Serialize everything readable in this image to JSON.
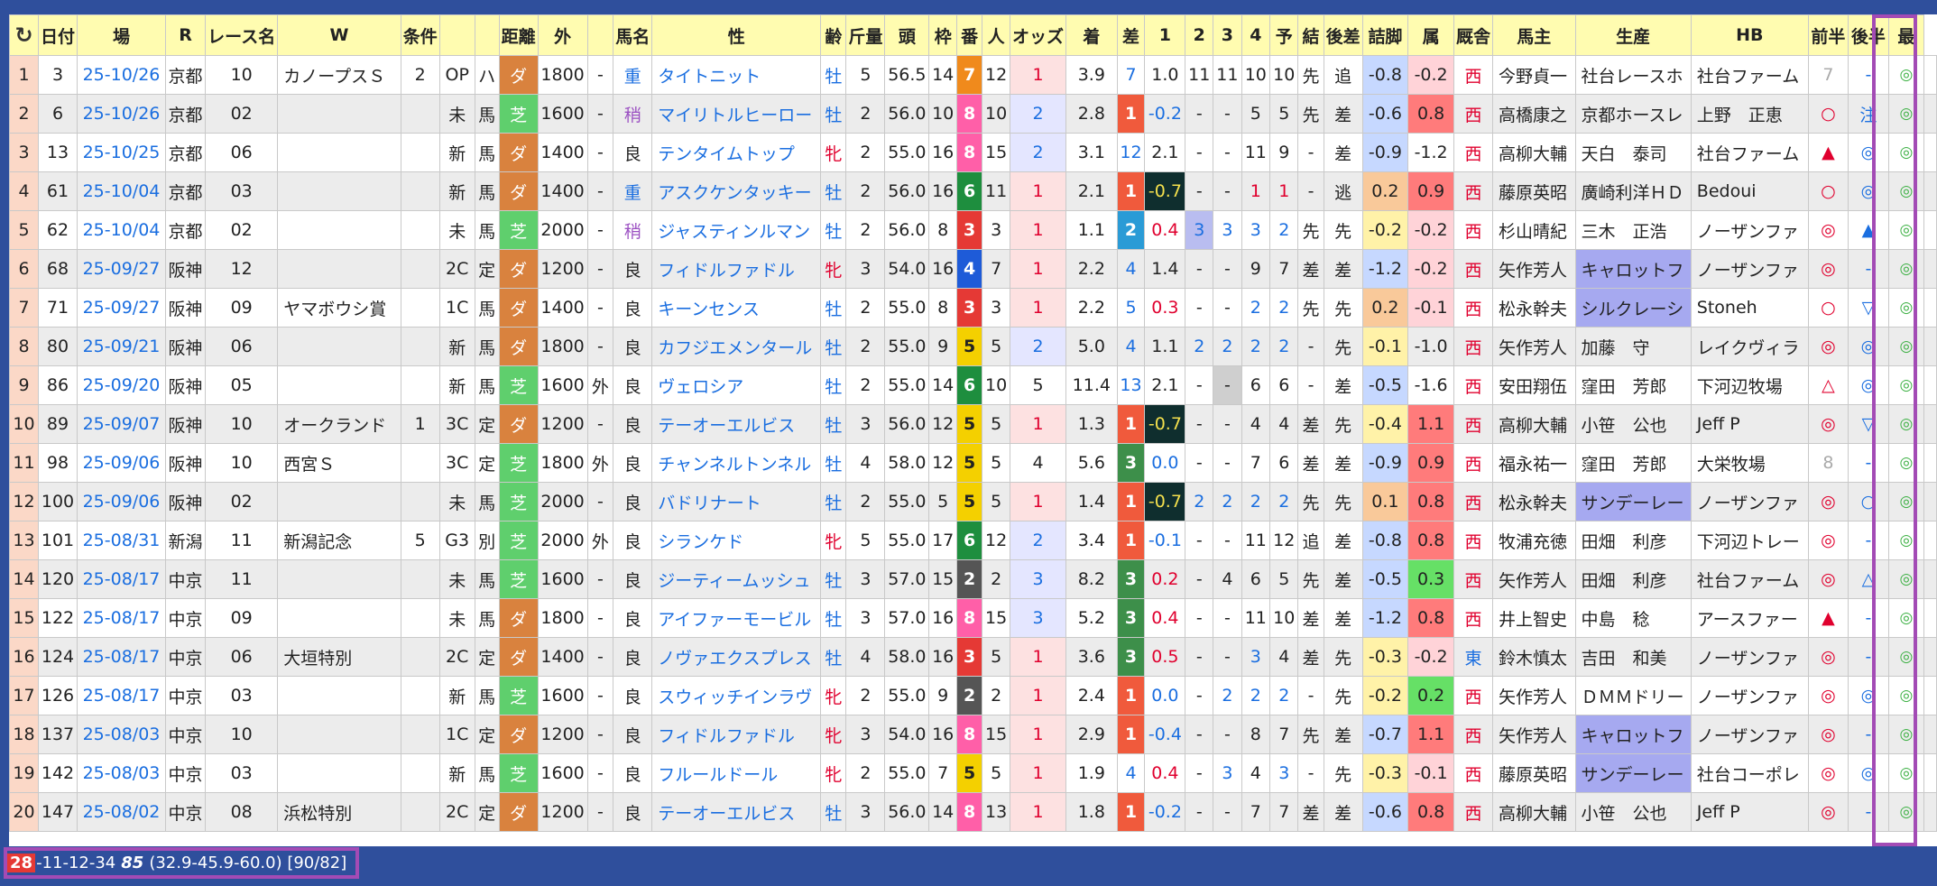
{
  "headers": [
    "↻",
    "日付",
    "場",
    "R",
    "レース名",
    "W",
    "条件",
    "",
    "",
    "距離",
    "外",
    "",
    "馬名",
    "性",
    "齢",
    "斤量",
    "頭",
    "枠",
    "番",
    "人",
    "オッズ",
    "着",
    "差",
    "1",
    "2",
    "3",
    "4",
    "予",
    "結",
    "後差",
    "詰脚",
    "属",
    "厩舎",
    "馬主",
    "生産",
    "HB",
    "前半",
    "後半",
    "最"
  ],
  "rows": [
    {
      "idx": "1",
      "no": "3",
      "date": "25-10/26",
      "place": "京都",
      "r": "10",
      "race": "カノープスＳ",
      "w": "2",
      "cond": "OP",
      "cond2": "ハ",
      "track": "ダ",
      "dist": "1800",
      "soto": "-",
      "baba": "重",
      "horse": "タイトニット",
      "sex": "牡",
      "age": "5",
      "kin": "56.5",
      "tou": "14",
      "waku": "7",
      "ban": "12",
      "nin": "1",
      "odds": "3.9",
      "chaku": "7",
      "sa": "1.0",
      "c1": "11",
      "c2": "11",
      "c3": "10",
      "c4": "10",
      "yo": "先",
      "ke": "追",
      "ato": "-0.8",
      "tsu": "-0.2",
      "zoku": "西",
      "kyu": "今野貞一",
      "owner": "社台レースホ",
      "prod": "社台ファーム",
      "hb": "7",
      "zen": "-",
      "kohan": "◎"
    },
    {
      "idx": "2",
      "no": "6",
      "date": "25-10/26",
      "place": "京都",
      "r": "02",
      "race": "",
      "w": "",
      "cond": "未",
      "cond2": "馬",
      "track": "芝",
      "dist": "1600",
      "soto": "-",
      "baba": "稍",
      "horse": "マイリトルヒーロー",
      "sex": "牡",
      "age": "2",
      "kin": "56.0",
      "tou": "10",
      "waku": "8",
      "ban": "10",
      "nin": "2",
      "odds": "2.8",
      "chaku": "1",
      "sa": "-0.2",
      "c1": "-",
      "c2": "-",
      "c3": "5",
      "c4": "5",
      "yo": "先",
      "ke": "差",
      "ato": "-0.6",
      "tsu": "0.8",
      "zoku": "西",
      "kyu": "高橋康之",
      "owner": "京都ホースレ",
      "prod": "上野　正恵",
      "hb": "○",
      "zen": "注",
      "kohan": "◎"
    },
    {
      "idx": "3",
      "no": "13",
      "date": "25-10/25",
      "place": "京都",
      "r": "06",
      "race": "",
      "w": "",
      "cond": "新",
      "cond2": "馬",
      "track": "ダ",
      "dist": "1400",
      "soto": "-",
      "baba": "良",
      "horse": "テンタイムトップ",
      "sex": "牝",
      "age": "2",
      "kin": "55.0",
      "tou": "16",
      "waku": "8",
      "ban": "15",
      "nin": "2",
      "odds": "3.1",
      "chaku": "12",
      "sa": "2.1",
      "c1": "-",
      "c2": "-",
      "c3": "11",
      "c4": "9",
      "yo": "-",
      "ke": "差",
      "ato": "-0.9",
      "tsu": "-1.2",
      "zoku": "西",
      "kyu": "高柳大輔",
      "owner": "天白　泰司",
      "prod": "社台ファーム",
      "hb": "▲",
      "zen": "◎",
      "kohan": "◎"
    },
    {
      "idx": "4",
      "no": "61",
      "date": "25-10/04",
      "place": "京都",
      "r": "03",
      "race": "",
      "w": "",
      "cond": "新",
      "cond2": "馬",
      "track": "ダ",
      "dist": "1400",
      "soto": "-",
      "baba": "重",
      "horse": "アスクケンタッキー",
      "sex": "牡",
      "age": "2",
      "kin": "56.0",
      "tou": "16",
      "waku": "6",
      "ban": "11",
      "nin": "1",
      "odds": "2.1",
      "chaku": "1",
      "sa": "-0.7",
      "c1": "-",
      "c2": "-",
      "c3": "1",
      "c4": "1",
      "yo": "-",
      "ke": "逃",
      "ato": "0.2",
      "tsu": "0.9",
      "zoku": "西",
      "kyu": "藤原英昭",
      "owner": "廣崎利洋ＨＤ",
      "prod": "Bedoui",
      "hb": "○",
      "zen": "◎",
      "kohan": "◎"
    },
    {
      "idx": "5",
      "no": "62",
      "date": "25-10/04",
      "place": "京都",
      "r": "02",
      "race": "",
      "w": "",
      "cond": "未",
      "cond2": "馬",
      "track": "芝",
      "dist": "2000",
      "soto": "-",
      "baba": "稍",
      "horse": "ジャスティンルマン",
      "sex": "牡",
      "age": "2",
      "kin": "56.0",
      "tou": "8",
      "waku": "3",
      "ban": "3",
      "nin": "1",
      "odds": "1.1",
      "chaku": "2",
      "sa": "0.4",
      "c1": "3",
      "c2": "3",
      "c3": "3",
      "c4": "2",
      "yo": "先",
      "ke": "先",
      "ato": "-0.2",
      "tsu": "-0.2",
      "zoku": "西",
      "kyu": "杉山晴紀",
      "owner": "三木　正浩",
      "prod": "ノーザンファ",
      "hb": "◎",
      "zen": "▲",
      "kohan": "◎"
    },
    {
      "idx": "6",
      "no": "68",
      "date": "25-09/27",
      "place": "阪神",
      "r": "12",
      "race": "",
      "w": "",
      "cond": "2C",
      "cond2": "定",
      "track": "ダ",
      "dist": "1200",
      "soto": "-",
      "baba": "良",
      "horse": "フィドルファドル",
      "sex": "牝",
      "age": "3",
      "kin": "54.0",
      "tou": "16",
      "waku": "4",
      "ban": "7",
      "nin": "1",
      "odds": "2.2",
      "chaku": "4",
      "sa": "1.4",
      "c1": "-",
      "c2": "-",
      "c3": "9",
      "c4": "7",
      "yo": "差",
      "ke": "差",
      "ato": "-1.2",
      "tsu": "-0.2",
      "zoku": "西",
      "kyu": "矢作芳人",
      "owner": "キャロットフ",
      "prod": "ノーザンファ",
      "hb": "◎",
      "zen": "-",
      "kohan": "◎"
    },
    {
      "idx": "7",
      "no": "71",
      "date": "25-09/27",
      "place": "阪神",
      "r": "09",
      "race": "ヤマボウシ賞",
      "w": "",
      "cond": "1C",
      "cond2": "馬",
      "track": "ダ",
      "dist": "1400",
      "soto": "-",
      "baba": "良",
      "horse": "キーンセンス",
      "sex": "牡",
      "age": "2",
      "kin": "55.0",
      "tou": "8",
      "waku": "3",
      "ban": "3",
      "nin": "1",
      "odds": "2.2",
      "chaku": "5",
      "sa": "0.3",
      "c1": "-",
      "c2": "-",
      "c3": "2",
      "c4": "2",
      "yo": "先",
      "ke": "先",
      "ato": "0.2",
      "tsu": "-0.1",
      "zoku": "西",
      "kyu": "松永幹夫",
      "owner": "シルクレーシ",
      "prod": "Stoneh",
      "hb": "○",
      "zen": "▽",
      "kohan": "◎"
    },
    {
      "idx": "8",
      "no": "80",
      "date": "25-09/21",
      "place": "阪神",
      "r": "06",
      "race": "",
      "w": "",
      "cond": "新",
      "cond2": "馬",
      "track": "ダ",
      "dist": "1800",
      "soto": "-",
      "baba": "良",
      "horse": "カフジエメンタール",
      "sex": "牡",
      "age": "2",
      "kin": "55.0",
      "tou": "9",
      "waku": "5",
      "ban": "5",
      "nin": "2",
      "odds": "5.0",
      "chaku": "4",
      "sa": "1.1",
      "c1": "2",
      "c2": "2",
      "c3": "2",
      "c4": "2",
      "yo": "-",
      "ke": "先",
      "ato": "-0.1",
      "tsu": "-1.0",
      "zoku": "西",
      "kyu": "矢作芳人",
      "owner": "加藤　守",
      "prod": "レイクヴィラ",
      "hb": "◎",
      "zen": "◎",
      "kohan": "◎"
    },
    {
      "idx": "9",
      "no": "86",
      "date": "25-09/20",
      "place": "阪神",
      "r": "05",
      "race": "",
      "w": "",
      "cond": "新",
      "cond2": "馬",
      "track": "芝",
      "dist": "1600",
      "soto": "外",
      "baba": "良",
      "horse": "ヴェロシア",
      "sex": "牡",
      "age": "2",
      "kin": "55.0",
      "tou": "14",
      "waku": "6",
      "ban": "10",
      "nin": "5",
      "odds": "11.4",
      "chaku": "13",
      "sa": "2.1",
      "c1": "-",
      "c2": "-",
      "c3": "6",
      "c4": "6",
      "yo": "-",
      "ke": "差",
      "ato": "-0.5",
      "tsu": "-1.6",
      "zoku": "西",
      "kyu": "安田翔伍",
      "owner": "窪田　芳郎",
      "prod": "下河辺牧場",
      "hb": "△",
      "zen": "◎",
      "kohan": "◎"
    },
    {
      "idx": "10",
      "no": "89",
      "date": "25-09/07",
      "place": "阪神",
      "r": "10",
      "race": "オークランド",
      "w": "1",
      "cond": "3C",
      "cond2": "定",
      "track": "ダ",
      "dist": "1200",
      "soto": "-",
      "baba": "良",
      "horse": "テーオーエルビス",
      "sex": "牡",
      "age": "3",
      "kin": "56.0",
      "tou": "12",
      "waku": "5",
      "ban": "5",
      "nin": "1",
      "odds": "1.3",
      "chaku": "1",
      "sa": "-0.7",
      "c1": "-",
      "c2": "-",
      "c3": "4",
      "c4": "4",
      "yo": "差",
      "ke": "先",
      "ato": "-0.4",
      "tsu": "1.1",
      "zoku": "西",
      "kyu": "高柳大輔",
      "owner": "小笹　公也",
      "prod": "Jeff P",
      "hb": "◎",
      "zen": "▽",
      "kohan": "◎"
    },
    {
      "idx": "11",
      "no": "98",
      "date": "25-09/06",
      "place": "阪神",
      "r": "10",
      "race": "西宮Ｓ",
      "w": "",
      "cond": "3C",
      "cond2": "定",
      "track": "芝",
      "dist": "1800",
      "soto": "外",
      "baba": "良",
      "horse": "チャンネルトンネル",
      "sex": "牡",
      "age": "4",
      "kin": "58.0",
      "tou": "12",
      "waku": "5",
      "ban": "5",
      "nin": "4",
      "odds": "5.6",
      "chaku": "3",
      "sa": "0.0",
      "c1": "-",
      "c2": "-",
      "c3": "7",
      "c4": "6",
      "yo": "差",
      "ke": "差",
      "ato": "-0.9",
      "tsu": "0.9",
      "zoku": "西",
      "kyu": "福永祐一",
      "owner": "窪田　芳郎",
      "prod": "大栄牧場",
      "hb": "8",
      "zen": "-",
      "kohan": "◎"
    },
    {
      "idx": "12",
      "no": "100",
      "date": "25-09/06",
      "place": "阪神",
      "r": "02",
      "race": "",
      "w": "",
      "cond": "未",
      "cond2": "馬",
      "track": "芝",
      "dist": "2000",
      "soto": "-",
      "baba": "良",
      "horse": "バドリナート",
      "sex": "牡",
      "age": "2",
      "kin": "55.0",
      "tou": "5",
      "waku": "5",
      "ban": "5",
      "nin": "1",
      "odds": "1.4",
      "chaku": "1",
      "sa": "-0.7",
      "c1": "2",
      "c2": "2",
      "c3": "2",
      "c4": "2",
      "yo": "先",
      "ke": "先",
      "ato": "0.1",
      "tsu": "0.8",
      "zoku": "西",
      "kyu": "松永幹夫",
      "owner": "サンデーレー",
      "prod": "ノーザンファ",
      "hb": "◎",
      "zen": "○",
      "kohan": "◎"
    },
    {
      "idx": "13",
      "no": "101",
      "date": "25-08/31",
      "place": "新潟",
      "r": "11",
      "race": "新潟記念",
      "w": "5",
      "cond": "G3",
      "cond2": "別",
      "track": "芝",
      "dist": "2000",
      "soto": "外",
      "baba": "良",
      "horse": "シランケド",
      "sex": "牝",
      "age": "5",
      "kin": "55.0",
      "tou": "17",
      "waku": "6",
      "ban": "12",
      "nin": "2",
      "odds": "3.4",
      "chaku": "1",
      "sa": "-0.1",
      "c1": "-",
      "c2": "-",
      "c3": "11",
      "c4": "12",
      "yo": "追",
      "ke": "差",
      "ato": "-0.8",
      "tsu": "0.8",
      "zoku": "西",
      "kyu": "牧浦充徳",
      "owner": "田畑　利彦",
      "prod": "下河辺トレー",
      "hb": "◎",
      "zen": "-",
      "kohan": "◎"
    },
    {
      "idx": "14",
      "no": "120",
      "date": "25-08/17",
      "place": "中京",
      "r": "11",
      "race": "",
      "w": "",
      "cond": "未",
      "cond2": "馬",
      "track": "芝",
      "dist": "1600",
      "soto": "-",
      "baba": "良",
      "horse": "ジーティームッシュ",
      "sex": "牡",
      "age": "3",
      "kin": "57.0",
      "tou": "15",
      "waku": "2",
      "ban": "2",
      "nin": "3",
      "odds": "8.2",
      "chaku": "3",
      "sa": "0.2",
      "c1": "-",
      "c2": "4",
      "c3": "6",
      "c4": "5",
      "yo": "先",
      "ke": "差",
      "ato": "-0.5",
      "tsu": "0.3",
      "zoku": "西",
      "kyu": "矢作芳人",
      "owner": "田畑　利彦",
      "prod": "社台ファーム",
      "hb": "◎",
      "zen": "△",
      "kohan": "◎"
    },
    {
      "idx": "15",
      "no": "122",
      "date": "25-08/17",
      "place": "中京",
      "r": "09",
      "race": "",
      "w": "",
      "cond": "未",
      "cond2": "馬",
      "track": "ダ",
      "dist": "1800",
      "soto": "-",
      "baba": "良",
      "horse": "アイファーモービル",
      "sex": "牡",
      "age": "3",
      "kin": "57.0",
      "tou": "16",
      "waku": "8",
      "ban": "15",
      "nin": "3",
      "odds": "5.2",
      "chaku": "3",
      "sa": "0.4",
      "c1": "-",
      "c2": "-",
      "c3": "11",
      "c4": "10",
      "yo": "差",
      "ke": "差",
      "ato": "-1.2",
      "tsu": "0.8",
      "zoku": "西",
      "kyu": "井上智史",
      "owner": "中島　稔",
      "prod": "アースファー",
      "hb": "▲",
      "zen": "-",
      "kohan": "◎"
    },
    {
      "idx": "16",
      "no": "124",
      "date": "25-08/17",
      "place": "中京",
      "r": "06",
      "race": "大垣特別",
      "w": "",
      "cond": "2C",
      "cond2": "定",
      "track": "ダ",
      "dist": "1400",
      "soto": "-",
      "baba": "良",
      "horse": "ノヴァエクスプレス",
      "sex": "牡",
      "age": "4",
      "kin": "58.0",
      "tou": "16",
      "waku": "3",
      "ban": "5",
      "nin": "1",
      "odds": "3.6",
      "chaku": "3",
      "sa": "0.5",
      "c1": "-",
      "c2": "-",
      "c3": "3",
      "c4": "4",
      "yo": "差",
      "ke": "先",
      "ato": "-0.3",
      "tsu": "-0.2",
      "zoku": "東",
      "kyu": "鈴木慎太",
      "owner": "吉田　和美",
      "prod": "ノーザンファ",
      "hb": "◎",
      "zen": "-",
      "kohan": "◎"
    },
    {
      "idx": "17",
      "no": "126",
      "date": "25-08/17",
      "place": "中京",
      "r": "03",
      "race": "",
      "w": "",
      "cond": "新",
      "cond2": "馬",
      "track": "芝",
      "dist": "1600",
      "soto": "-",
      "baba": "良",
      "horse": "スウィッチインラヴ",
      "sex": "牝",
      "age": "2",
      "kin": "55.0",
      "tou": "9",
      "waku": "2",
      "ban": "2",
      "nin": "1",
      "odds": "2.4",
      "chaku": "1",
      "sa": "0.0",
      "c1": "-",
      "c2": "2",
      "c3": "2",
      "c4": "2",
      "yo": "-",
      "ke": "先",
      "ato": "-0.2",
      "tsu": "0.2",
      "zoku": "西",
      "kyu": "矢作芳人",
      "owner": "ＤＭＭドリー",
      "prod": "ノーザンファ",
      "hb": "◎",
      "zen": "◎",
      "kohan": "◎"
    },
    {
      "idx": "18",
      "no": "137",
      "date": "25-08/03",
      "place": "中京",
      "r": "10",
      "race": "",
      "w": "",
      "cond": "1C",
      "cond2": "定",
      "track": "ダ",
      "dist": "1200",
      "soto": "-",
      "baba": "良",
      "horse": "フィドルファドル",
      "sex": "牝",
      "age": "3",
      "kin": "54.0",
      "tou": "16",
      "waku": "8",
      "ban": "15",
      "nin": "1",
      "odds": "2.9",
      "chaku": "1",
      "sa": "-0.4",
      "c1": "-",
      "c2": "-",
      "c3": "8",
      "c4": "7",
      "yo": "先",
      "ke": "差",
      "ato": "-0.7",
      "tsu": "1.1",
      "zoku": "西",
      "kyu": "矢作芳人",
      "owner": "キャロットフ",
      "prod": "ノーザンファ",
      "hb": "◎",
      "zen": "-",
      "kohan": "◎"
    },
    {
      "idx": "19",
      "no": "142",
      "date": "25-08/03",
      "place": "中京",
      "r": "03",
      "race": "",
      "w": "",
      "cond": "新",
      "cond2": "馬",
      "track": "芝",
      "dist": "1600",
      "soto": "-",
      "baba": "良",
      "horse": "フルールドール",
      "sex": "牝",
      "age": "2",
      "kin": "55.0",
      "tou": "7",
      "waku": "5",
      "ban": "5",
      "nin": "1",
      "odds": "1.9",
      "chaku": "4",
      "sa": "0.4",
      "c1": "-",
      "c2": "3",
      "c3": "4",
      "c4": "3",
      "yo": "-",
      "ke": "先",
      "ato": "-0.3",
      "tsu": "-0.1",
      "zoku": "西",
      "kyu": "藤原英昭",
      "owner": "サンデーレー",
      "prod": "社台コーポレ",
      "hb": "◎",
      "zen": "◎",
      "kohan": "◎"
    },
    {
      "idx": "20",
      "no": "147",
      "date": "25-08/02",
      "place": "中京",
      "r": "08",
      "race": "浜松特別",
      "w": "",
      "cond": "2C",
      "cond2": "定",
      "track": "ダ",
      "dist": "1200",
      "soto": "-",
      "baba": "良",
      "horse": "テーオーエルビス",
      "sex": "牡",
      "age": "3",
      "kin": "56.0",
      "tou": "14",
      "waku": "8",
      "ban": "13",
      "nin": "1",
      "odds": "1.8",
      "chaku": "1",
      "sa": "-0.2",
      "c1": "-",
      "c2": "-",
      "c3": "7",
      "c4": "7",
      "yo": "差",
      "ke": "差",
      "ato": "-0.6",
      "tsu": "0.8",
      "zoku": "西",
      "kyu": "高柳大輔",
      "owner": "小笹　公也",
      "prod": "Jeff P",
      "hb": "◎",
      "zen": "-",
      "kohan": "◎"
    }
  ],
  "status": {
    "badge": "28",
    "record": "-11-12-34",
    "score": "85",
    "detail": "(32.9-45.9-60.0) [90/82]"
  },
  "colors": {
    "background": "#2f4f9c",
    "header": "#fffcb0",
    "highlight": "#a34bb5"
  }
}
